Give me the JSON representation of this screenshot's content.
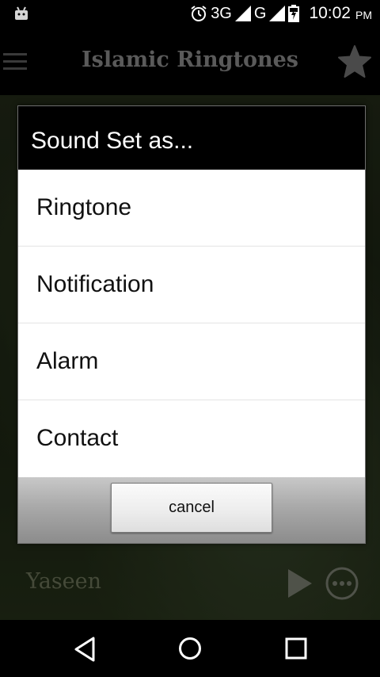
{
  "status_bar": {
    "network_1": "3G",
    "network_2": "G",
    "time": "10:02",
    "ampm": "PM"
  },
  "app_bar": {
    "title": "Islamic Ringtones"
  },
  "background_list": {
    "visible_item": "Yaseen"
  },
  "dialog": {
    "title": "Sound Set as...",
    "options": [
      {
        "label": "Ringtone"
      },
      {
        "label": "Notification"
      },
      {
        "label": "Alarm"
      },
      {
        "label": "Contact"
      }
    ],
    "cancel_label": "cancel"
  },
  "icons": {
    "status_left": "android-icon",
    "alarm": "alarm-icon",
    "signal": "signal-icon",
    "battery": "battery-icon",
    "menu": "menu-icon",
    "favorite": "star-icon",
    "play": "play-icon",
    "more": "more-icon",
    "back": "back-icon",
    "home": "home-icon",
    "recents": "recents-icon"
  }
}
